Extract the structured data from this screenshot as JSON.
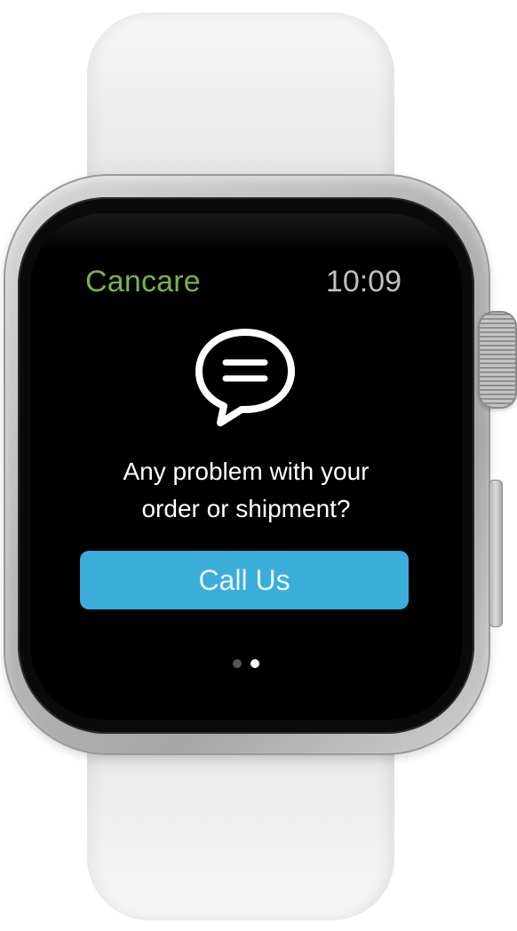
{
  "header": {
    "app_name": "Cancare",
    "time": "10:09"
  },
  "content": {
    "icon": "chat-bubble-icon",
    "message_line1": "Any problem with your",
    "message_line2": "order or shipment?",
    "call_button_label": "Call Us"
  },
  "pager": {
    "total": 2,
    "current": 2
  },
  "colors": {
    "accent": "#3aaddb",
    "app_name": "#79b24b",
    "screen_bg": "#000000"
  }
}
